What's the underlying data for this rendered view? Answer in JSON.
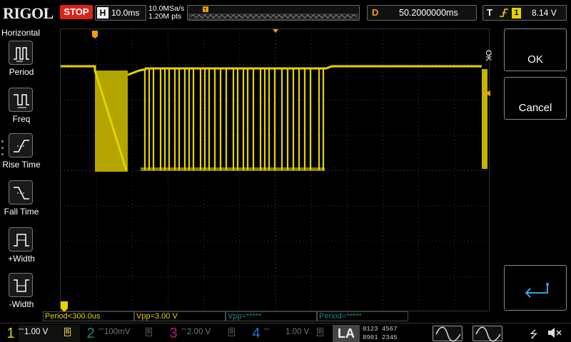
{
  "header": {
    "brand": "RIGOL",
    "run_state": "STOP",
    "horizontal_letter": "H",
    "timebase": "10.0ms",
    "sample_rate": "10.0MSa/s",
    "memory_depth": "1.20M pts",
    "delay_letter": "D",
    "delay": "50.2000000ms",
    "trigger_letter": "T",
    "trigger_edge": "rising-edge-icon",
    "trigger_source": "1",
    "trigger_level": "8.14 V",
    "colors": {
      "stop": "#d9241c",
      "ch1": "#e6d200",
      "ch2": "#1a8a8a",
      "ch3": "#c0178c",
      "ch4": "#2b6fd1",
      "delay": "#f39c12"
    }
  },
  "left_menu": {
    "title": "Horizontal",
    "items": [
      {
        "label": "Period",
        "icon": "period-icon"
      },
      {
        "label": "Freq",
        "icon": "frequency-icon"
      },
      {
        "label": "Rise Time",
        "icon": "rise-time-icon"
      },
      {
        "label": "Fall Time",
        "icon": "fall-time-icon"
      },
      {
        "label": "+Width",
        "icon": "positive-width-icon"
      },
      {
        "label": "-Width",
        "icon": "negative-width-icon"
      }
    ]
  },
  "right_menu": {
    "ok_vertical": "OK",
    "ok": "OK",
    "cancel": "Cancel",
    "enter_icon": "enter-icon"
  },
  "measurements": [
    {
      "text": "Period<300.0us",
      "color": "#e6d200"
    },
    {
      "text": "Vpp=3.00 V",
      "color": "#e6d200"
    },
    {
      "text": "Vpp=*****",
      "color": "#1a8a8a"
    },
    {
      "text": "Period=*****",
      "color": "#1a8a8a"
    }
  ],
  "channels": [
    {
      "num": "1",
      "scale": "1.00 V",
      "color": "#e6d200",
      "active": true
    },
    {
      "num": "2",
      "scale": "100mV",
      "color": "#1a8a8a",
      "active": false
    },
    {
      "num": "3",
      "scale": "2.00 V",
      "color": "#c0178c",
      "active": false
    },
    {
      "num": "4",
      "scale": "1.00 V",
      "color": "#2b6fd1",
      "active": false
    }
  ],
  "la": {
    "label": "LA",
    "rows": [
      "0123 4567",
      "8901 2345"
    ]
  },
  "status_icons": {
    "usb": "usb-icon",
    "speaker": "speaker-muted-icon"
  }
}
